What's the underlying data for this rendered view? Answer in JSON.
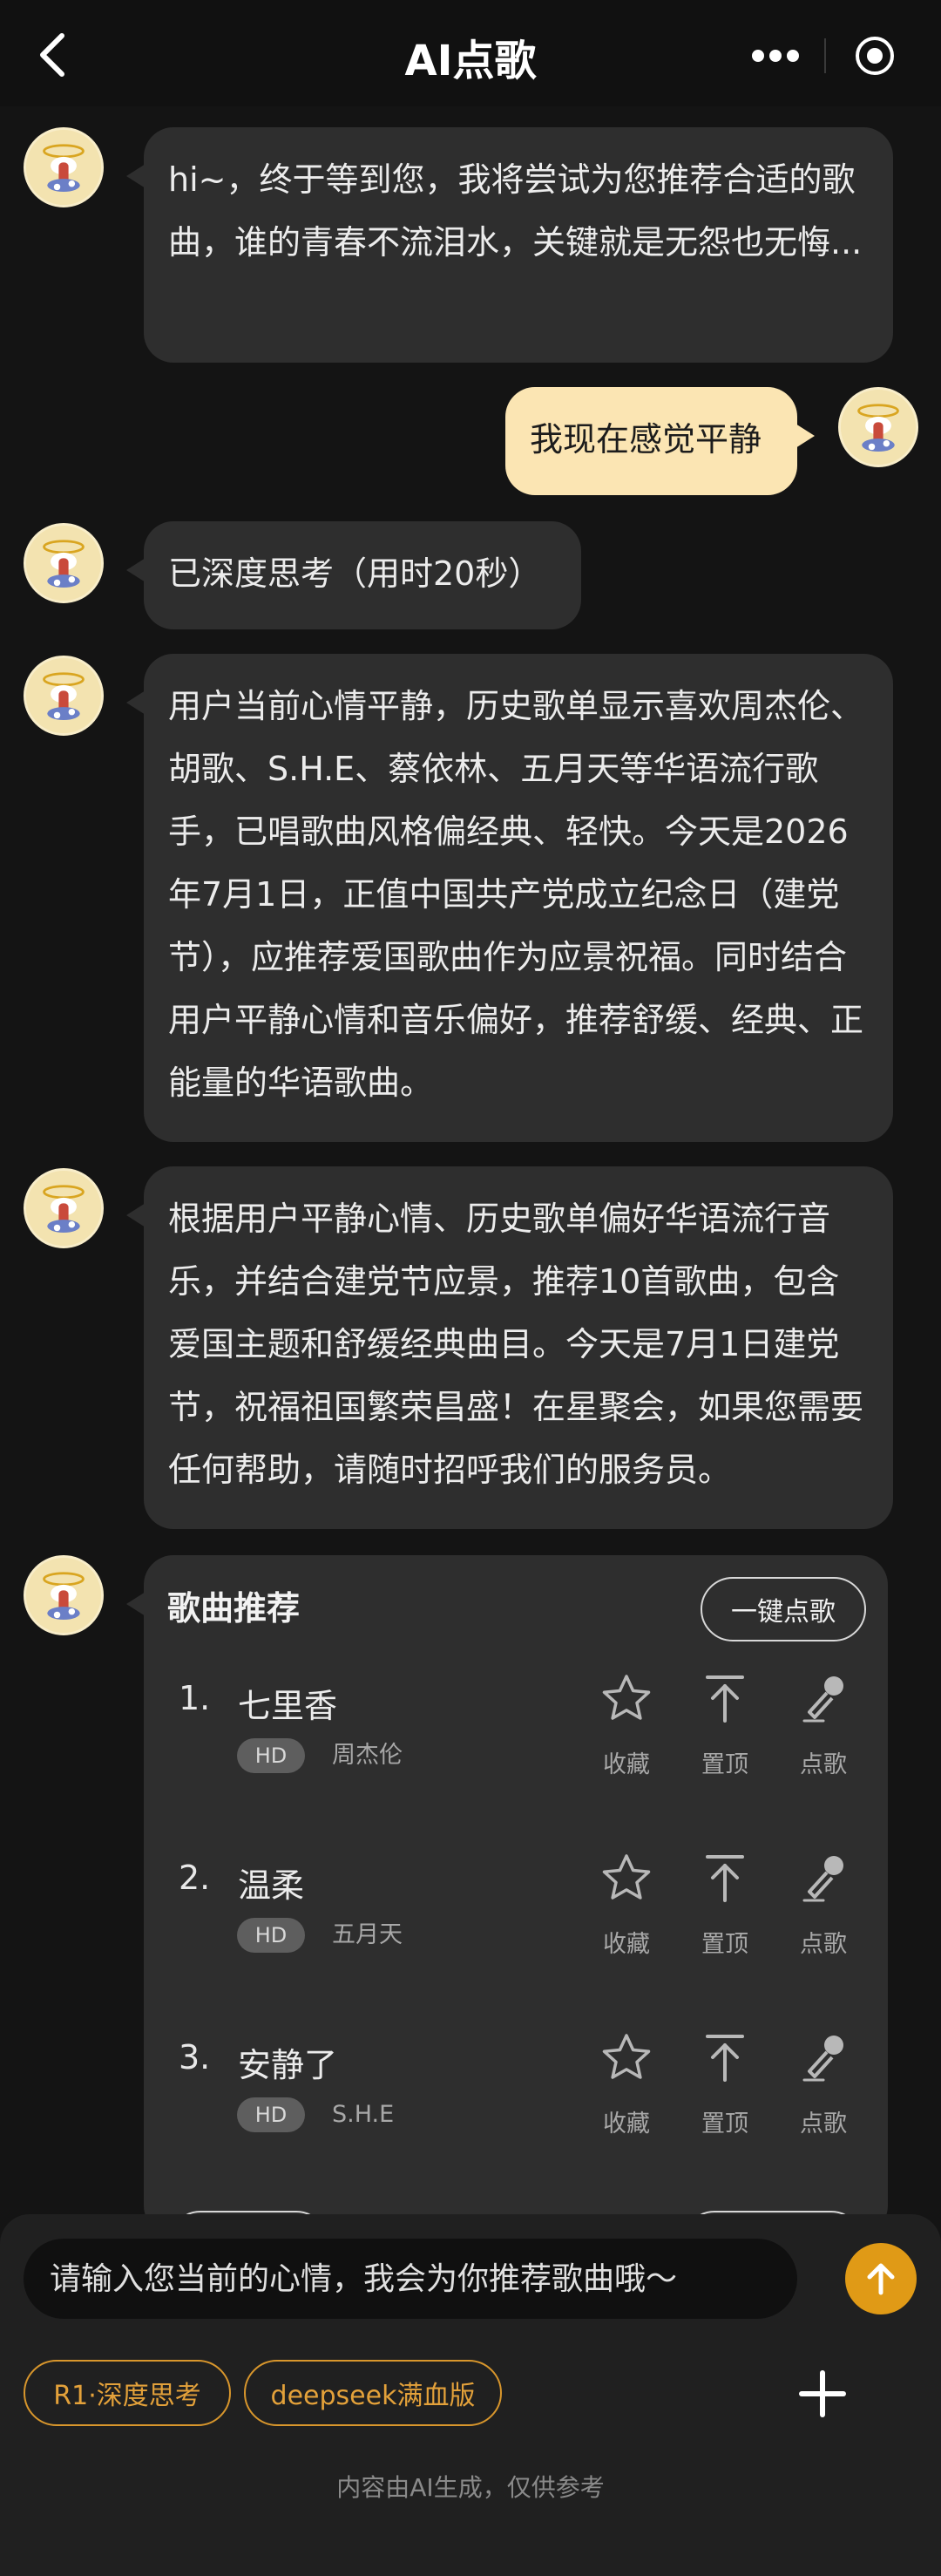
{
  "header": {
    "title": "AI点歌"
  },
  "messages": [
    {
      "role": "ai",
      "text": "hi~，终于等到您，我将尝试为您推荐合适的歌曲，谁的青春不流泪水，关键就是无怨也无悔..."
    },
    {
      "role": "user",
      "text": "我现在感觉平静"
    },
    {
      "role": "ai",
      "text": "已深度思考（用时20秒）"
    },
    {
      "role": "ai",
      "text": "用户当前心情平静，历史歌单显示喜欢周杰伦、胡歌、S.H.E、蔡依林、五月天等华语流行歌手，已唱歌曲风格偏经典、轻快。今天是2026年7月1日，正值中国共产党成立纪念日（建党节），应推荐爱国歌曲作为应景祝福。同时结合用户平静心情和音乐偏好，推荐舒缓、经典、正能量的华语歌曲。"
    },
    {
      "role": "ai",
      "text": "根据用户平静心情、历史歌单偏好华语流行音乐，并结合建党节应景，推荐10首歌曲，包含爱国主题和舒缓经典曲目。今天是7月1日建党节，祝福祖国繁荣昌盛！在星聚会，如果您需要任何帮助，请随时招呼我们的服务员。"
    }
  ],
  "recommendations": {
    "title": "歌曲推荐",
    "one_click_label": "一键点歌",
    "action_labels": {
      "favorite": "收藏",
      "pin": "置顶",
      "order": "点歌"
    },
    "songs": [
      {
        "num": "1.",
        "name": "七里香",
        "quality": "HD",
        "artist": "周杰伦"
      },
      {
        "num": "2.",
        "name": "温柔",
        "quality": "HD",
        "artist": "五月天"
      },
      {
        "num": "3.",
        "name": "安静了",
        "quality": "HD",
        "artist": "S.H.E"
      }
    ]
  },
  "composer": {
    "placeholder": "请输入您当前的心情，我会为你推荐歌曲哦～",
    "chips": [
      "R1·深度思考",
      "deepseek满血版"
    ],
    "disclaimer": "内容由AI生成，仅供参考"
  },
  "colors": {
    "accent": "#e09a16",
    "user_bubble": "#fbe5b3",
    "ai_bubble": "#2e2e2e",
    "background": "#141414"
  },
  "icons": [
    "back-arrow-icon",
    "more-dots-icon",
    "target-icon",
    "star-icon",
    "pin-top-icon",
    "microphone-icon",
    "send-arrow-icon",
    "plus-icon"
  ]
}
